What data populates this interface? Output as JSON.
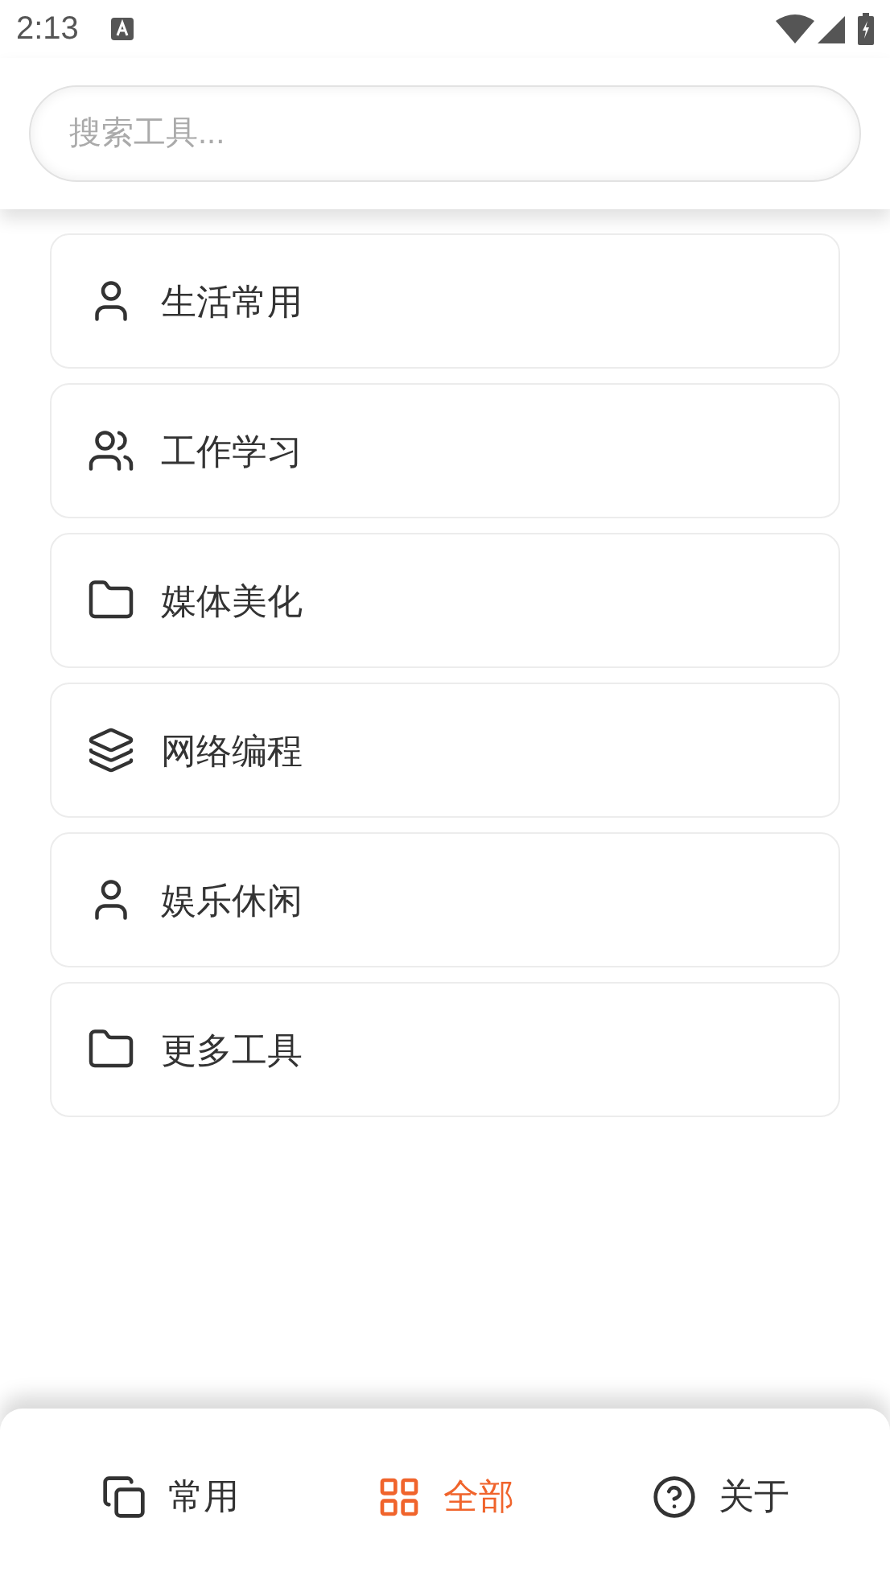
{
  "status_bar": {
    "time": "2:13"
  },
  "search": {
    "placeholder": "搜索工具..."
  },
  "categories": [
    {
      "label": "生活常用"
    },
    {
      "label": "工作学习"
    },
    {
      "label": "媒体美化"
    },
    {
      "label": "网络编程"
    },
    {
      "label": "娱乐休闲"
    },
    {
      "label": "更多工具"
    }
  ],
  "bottom_nav": [
    {
      "label": "常用",
      "selected": false
    },
    {
      "label": "全部",
      "selected": true
    },
    {
      "label": "关于",
      "selected": false
    }
  ]
}
